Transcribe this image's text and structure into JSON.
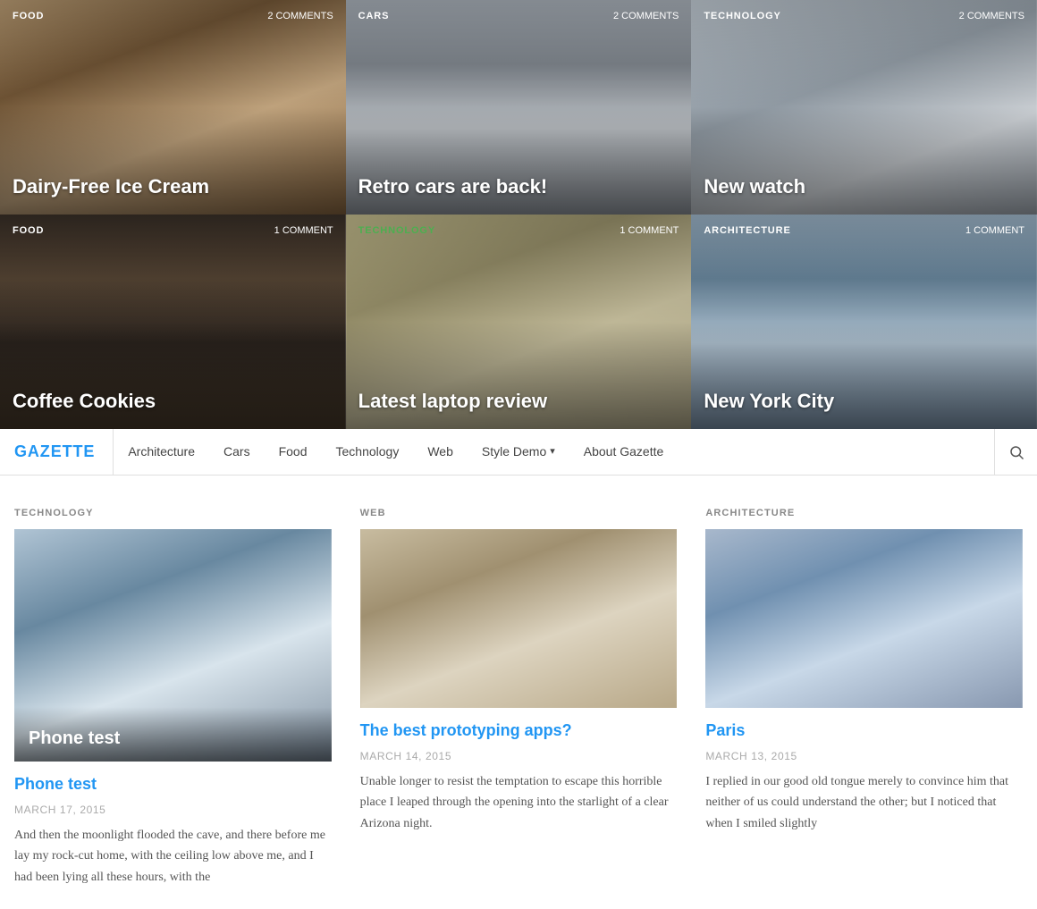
{
  "hero": {
    "cells": [
      {
        "id": "food1",
        "category": "FOOD",
        "category_green": false,
        "comments": "2 COMMENTS",
        "title": "Dairy-Free Ice Cream",
        "bg_class": "bg-food1"
      },
      {
        "id": "cars1",
        "category": "CARS",
        "category_green": false,
        "comments": "2 COMMENTS",
        "title": "Retro cars are back!",
        "bg_class": "bg-cars1"
      },
      {
        "id": "tech1",
        "category": "TECHNOLOGY",
        "category_green": false,
        "comments": "2 COMMENTS",
        "title": "New watch",
        "bg_class": "bg-tech1"
      },
      {
        "id": "food2",
        "category": "FOOD",
        "category_green": false,
        "comments": "1 COMMENT",
        "title": "Coffee Cookies",
        "bg_class": "bg-food2"
      },
      {
        "id": "tech2",
        "category": "TECHNOLOGY",
        "category_green": true,
        "comments": "1 COMMENT",
        "title": "Latest laptop review",
        "bg_class": "bg-tech2"
      },
      {
        "id": "arch1",
        "category": "ARCHITECTURE",
        "category_green": false,
        "comments": "1 COMMENT",
        "title": "New York City",
        "bg_class": "bg-arch1"
      }
    ]
  },
  "navbar": {
    "brand": "GAZETTE",
    "links": [
      {
        "label": "Architecture",
        "dropdown": false
      },
      {
        "label": "Cars",
        "dropdown": false
      },
      {
        "label": "Food",
        "dropdown": false
      },
      {
        "label": "Technology",
        "dropdown": false
      },
      {
        "label": "Web",
        "dropdown": false
      },
      {
        "label": "Style Demo",
        "dropdown": true
      },
      {
        "label": "About Gazette",
        "dropdown": false
      }
    ]
  },
  "articles": [
    {
      "id": "phone-test",
      "category": "TECHNOLOGY",
      "image_class": "img-phone",
      "title": "Phone test",
      "date": "MARCH 17, 2015",
      "excerpt": "And then the moonlight flooded the cave, and there before me lay my rock-cut home, with the ceiling low above me, and I had been lying all these hours, with the",
      "featured": true
    },
    {
      "id": "proto-apps",
      "category": "WEB",
      "image_class": "img-proto",
      "title": "The best prototyping apps?",
      "date": "MARCH 14, 2015",
      "excerpt": "Unable longer to resist the temptation to escape this horrible place I leaped through the opening into the starlight of a clear Arizona night.",
      "featured": false
    },
    {
      "id": "paris",
      "category": "ARCHITECTURE",
      "image_class": "img-paris",
      "title": "Paris",
      "date": "MARCH 13, 2015",
      "excerpt": "I replied in our good old tongue merely to convince him that neither of us could understand the other; but I noticed that when I smiled slightly",
      "featured": false
    }
  ]
}
